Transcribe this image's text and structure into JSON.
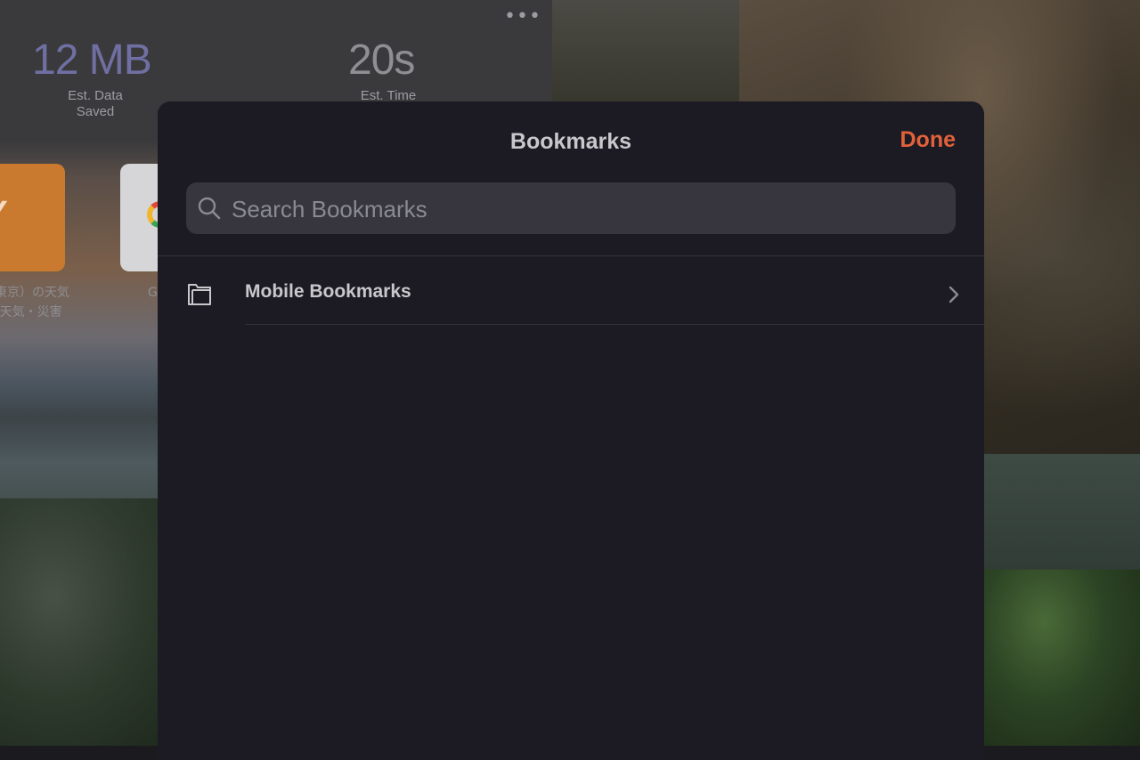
{
  "background": {
    "stats": [
      {
        "value": "12 MB",
        "caption_line1": "Est. Data",
        "caption_line2": "Saved",
        "color": "#6f6fa3"
      },
      {
        "value": "20s",
        "caption_line1": "Est. Time",
        "caption_line2": "",
        "color": "#8e8e93"
      }
    ],
    "more_label": "•••",
    "tiles": [
      {
        "letter": "Y",
        "label_line1": "東京）の天気",
        "label_line2": "!天気・災害"
      },
      {
        "letter": "",
        "label_line1": "G",
        "label_line2": ""
      }
    ]
  },
  "sheet": {
    "title": "Bookmarks",
    "done_label": "Done",
    "done_color": "#e2613a",
    "search": {
      "placeholder": "Search Bookmarks",
      "value": ""
    },
    "items": [
      {
        "label": "Mobile Bookmarks",
        "icon": "folder-icon"
      }
    ]
  }
}
